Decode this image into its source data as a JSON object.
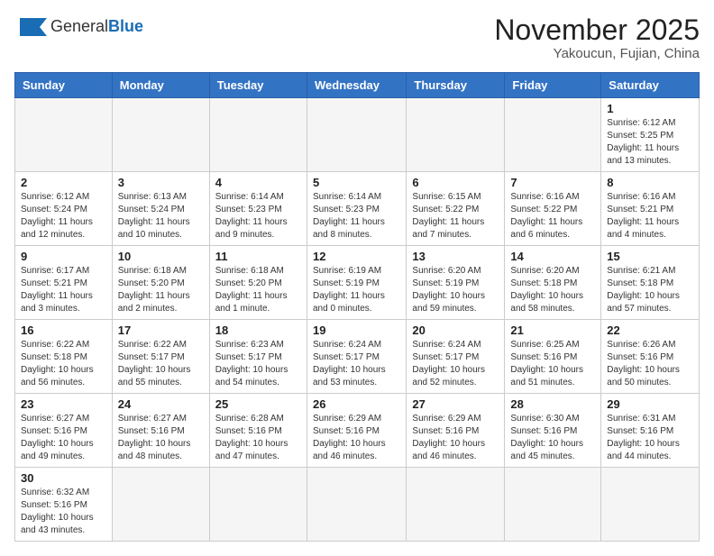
{
  "header": {
    "logo_general": "General",
    "logo_blue": "Blue",
    "month": "November 2025",
    "location": "Yakoucun, Fujian, China"
  },
  "weekdays": [
    "Sunday",
    "Monday",
    "Tuesday",
    "Wednesday",
    "Thursday",
    "Friday",
    "Saturday"
  ],
  "weeks": [
    [
      {
        "day": "",
        "info": ""
      },
      {
        "day": "",
        "info": ""
      },
      {
        "day": "",
        "info": ""
      },
      {
        "day": "",
        "info": ""
      },
      {
        "day": "",
        "info": ""
      },
      {
        "day": "",
        "info": ""
      },
      {
        "day": "1",
        "info": "Sunrise: 6:12 AM\nSunset: 5:25 PM\nDaylight: 11 hours\nand 13 minutes."
      }
    ],
    [
      {
        "day": "2",
        "info": "Sunrise: 6:12 AM\nSunset: 5:24 PM\nDaylight: 11 hours\nand 12 minutes."
      },
      {
        "day": "3",
        "info": "Sunrise: 6:13 AM\nSunset: 5:24 PM\nDaylight: 11 hours\nand 10 minutes."
      },
      {
        "day": "4",
        "info": "Sunrise: 6:14 AM\nSunset: 5:23 PM\nDaylight: 11 hours\nand 9 minutes."
      },
      {
        "day": "5",
        "info": "Sunrise: 6:14 AM\nSunset: 5:23 PM\nDaylight: 11 hours\nand 8 minutes."
      },
      {
        "day": "6",
        "info": "Sunrise: 6:15 AM\nSunset: 5:22 PM\nDaylight: 11 hours\nand 7 minutes."
      },
      {
        "day": "7",
        "info": "Sunrise: 6:16 AM\nSunset: 5:22 PM\nDaylight: 11 hours\nand 6 minutes."
      },
      {
        "day": "8",
        "info": "Sunrise: 6:16 AM\nSunset: 5:21 PM\nDaylight: 11 hours\nand 4 minutes."
      }
    ],
    [
      {
        "day": "9",
        "info": "Sunrise: 6:17 AM\nSunset: 5:21 PM\nDaylight: 11 hours\nand 3 minutes."
      },
      {
        "day": "10",
        "info": "Sunrise: 6:18 AM\nSunset: 5:20 PM\nDaylight: 11 hours\nand 2 minutes."
      },
      {
        "day": "11",
        "info": "Sunrise: 6:18 AM\nSunset: 5:20 PM\nDaylight: 11 hours\nand 1 minute."
      },
      {
        "day": "12",
        "info": "Sunrise: 6:19 AM\nSunset: 5:19 PM\nDaylight: 11 hours\nand 0 minutes."
      },
      {
        "day": "13",
        "info": "Sunrise: 6:20 AM\nSunset: 5:19 PM\nDaylight: 10 hours\nand 59 minutes."
      },
      {
        "day": "14",
        "info": "Sunrise: 6:20 AM\nSunset: 5:18 PM\nDaylight: 10 hours\nand 58 minutes."
      },
      {
        "day": "15",
        "info": "Sunrise: 6:21 AM\nSunset: 5:18 PM\nDaylight: 10 hours\nand 57 minutes."
      }
    ],
    [
      {
        "day": "16",
        "info": "Sunrise: 6:22 AM\nSunset: 5:18 PM\nDaylight: 10 hours\nand 56 minutes."
      },
      {
        "day": "17",
        "info": "Sunrise: 6:22 AM\nSunset: 5:17 PM\nDaylight: 10 hours\nand 55 minutes."
      },
      {
        "day": "18",
        "info": "Sunrise: 6:23 AM\nSunset: 5:17 PM\nDaylight: 10 hours\nand 54 minutes."
      },
      {
        "day": "19",
        "info": "Sunrise: 6:24 AM\nSunset: 5:17 PM\nDaylight: 10 hours\nand 53 minutes."
      },
      {
        "day": "20",
        "info": "Sunrise: 6:24 AM\nSunset: 5:17 PM\nDaylight: 10 hours\nand 52 minutes."
      },
      {
        "day": "21",
        "info": "Sunrise: 6:25 AM\nSunset: 5:16 PM\nDaylight: 10 hours\nand 51 minutes."
      },
      {
        "day": "22",
        "info": "Sunrise: 6:26 AM\nSunset: 5:16 PM\nDaylight: 10 hours\nand 50 minutes."
      }
    ],
    [
      {
        "day": "23",
        "info": "Sunrise: 6:27 AM\nSunset: 5:16 PM\nDaylight: 10 hours\nand 49 minutes."
      },
      {
        "day": "24",
        "info": "Sunrise: 6:27 AM\nSunset: 5:16 PM\nDaylight: 10 hours\nand 48 minutes."
      },
      {
        "day": "25",
        "info": "Sunrise: 6:28 AM\nSunset: 5:16 PM\nDaylight: 10 hours\nand 47 minutes."
      },
      {
        "day": "26",
        "info": "Sunrise: 6:29 AM\nSunset: 5:16 PM\nDaylight: 10 hours\nand 46 minutes."
      },
      {
        "day": "27",
        "info": "Sunrise: 6:29 AM\nSunset: 5:16 PM\nDaylight: 10 hours\nand 46 minutes."
      },
      {
        "day": "28",
        "info": "Sunrise: 6:30 AM\nSunset: 5:16 PM\nDaylight: 10 hours\nand 45 minutes."
      },
      {
        "day": "29",
        "info": "Sunrise: 6:31 AM\nSunset: 5:16 PM\nDaylight: 10 hours\nand 44 minutes."
      }
    ],
    [
      {
        "day": "30",
        "info": "Sunrise: 6:32 AM\nSunset: 5:16 PM\nDaylight: 10 hours\nand 43 minutes."
      },
      {
        "day": "",
        "info": ""
      },
      {
        "day": "",
        "info": ""
      },
      {
        "day": "",
        "info": ""
      },
      {
        "day": "",
        "info": ""
      },
      {
        "day": "",
        "info": ""
      },
      {
        "day": "",
        "info": ""
      }
    ]
  ]
}
